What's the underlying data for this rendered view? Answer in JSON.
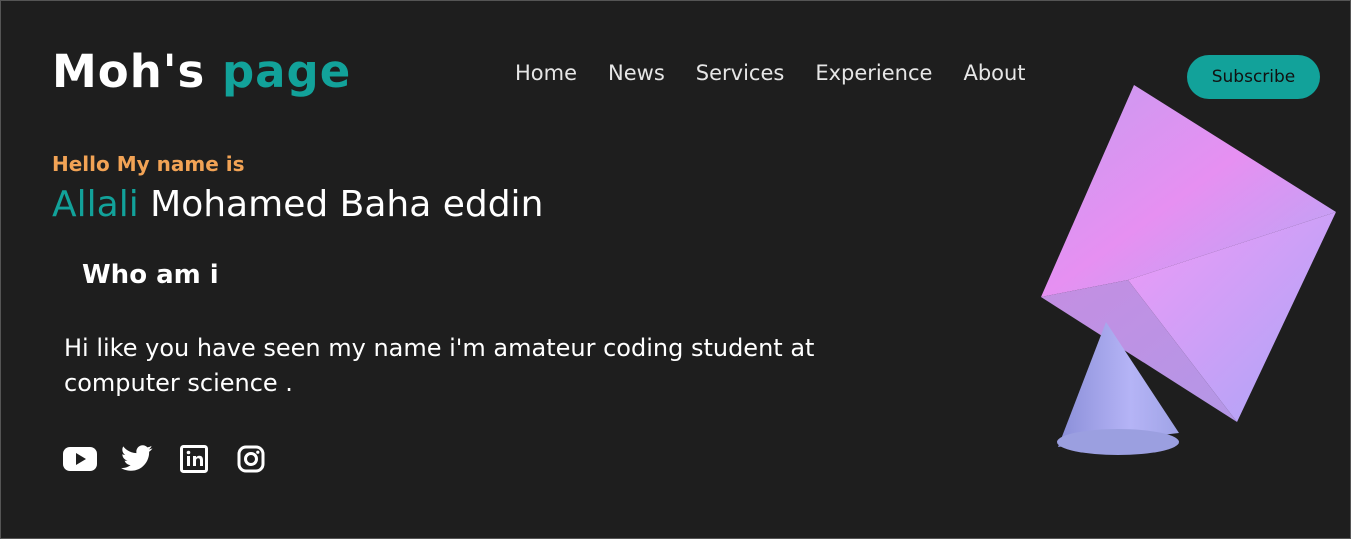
{
  "header": {
    "logo_main": "Moh's",
    "logo_accent": "page",
    "nav": [
      "Home",
      "News",
      "Services",
      "Experience",
      "About"
    ],
    "subscribe": "Subscribe"
  },
  "hero": {
    "greeting": "Hello My name is",
    "first_name": "Allali",
    "rest_name": "Mohamed Baha eddin",
    "section_title": "Who am i",
    "bio": "Hi like you have seen my name i'm amateur coding student at computer science ."
  },
  "socials": [
    "youtube-icon",
    "twitter-icon",
    "linkedin-icon",
    "instagram-icon"
  ],
  "colors": {
    "background": "#1e1e1e",
    "accent": "#12a29a",
    "greeting": "#f2a355"
  }
}
